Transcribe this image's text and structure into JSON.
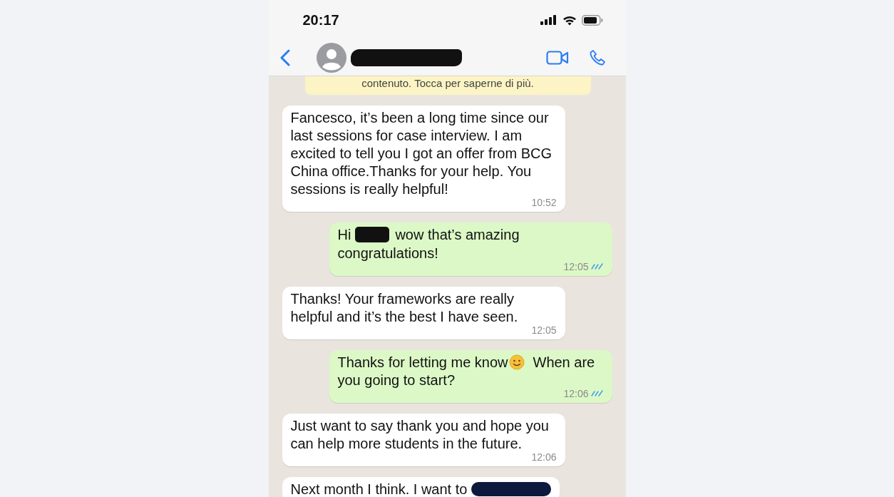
{
  "status_bar": {
    "time": "20:17"
  },
  "header": {
    "name_redacted": true
  },
  "notice": {
    "text": "contenuto. Tocca per saperne di più."
  },
  "messages": [
    {
      "kind": "incoming",
      "parts": [
        {
          "kind": "text",
          "text": "Fancesco, it’s been a long time since our last sessions for case interview. I am excited to tell you  I got an offer from BCG China office.Thanks for your help. You sessions is really helpful!"
        }
      ],
      "time": "10:52"
    },
    {
      "kind": "outgoing",
      "read": true,
      "parts": [
        {
          "kind": "text",
          "text": "Hi"
        },
        {
          "kind": "redaction"
        },
        {
          "kind": "text",
          "text": "wow that’s amazing"
        },
        {
          "kind": "text",
          "text": "congratulations!"
        }
      ],
      "time": "12:05"
    },
    {
      "kind": "incoming",
      "parts": [
        {
          "kind": "text",
          "text": "Thanks! Your frameworks are really helpful and it’s the best I have seen."
        }
      ],
      "time": "12:05"
    },
    {
      "kind": "outgoing",
      "read": true,
      "parts": [
        {
          "kind": "text",
          "text": "Thanks for letting me know"
        },
        {
          "kind": "emoji"
        },
        {
          "kind": "text",
          "text": "When are"
        },
        {
          "kind": "text",
          "text": "you going to start?"
        }
      ],
      "time": "12:06"
    },
    {
      "kind": "incoming",
      "parts": [
        {
          "kind": "text",
          "text": "Just want to say thank you and hope you can help more students in the future."
        }
      ],
      "time": "12:06"
    },
    {
      "kind": "incoming",
      "parts": [
        {
          "kind": "text",
          "text": "Next month I think. I want to"
        },
        {
          "kind": "redaction"
        }
      ]
    }
  ]
}
